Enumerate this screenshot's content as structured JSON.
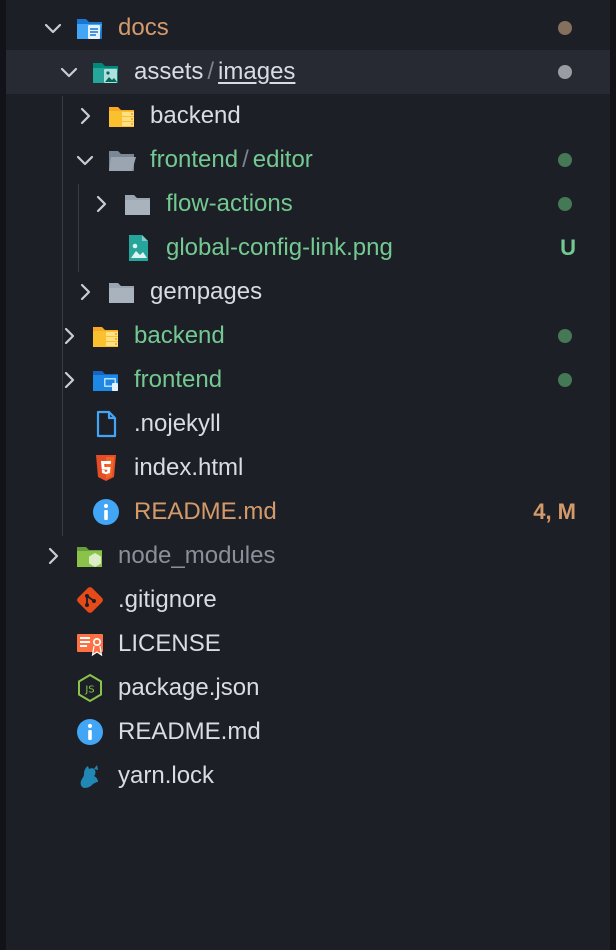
{
  "colors": {
    "modified": "#d49a6a",
    "untracked": "#73c991",
    "default": "#d8dce3",
    "ignored": "#8a8f99",
    "dot_modified": "#84705d",
    "dot_neutral": "#9a9ca3",
    "dot_untracked": "#457955"
  },
  "tree": [
    {
      "key": "docs",
      "label": "docs",
      "chevron": "down",
      "icon": "folder-docs-open-icon",
      "color": "modified",
      "dot": "dot_modified"
    },
    {
      "key": "assets",
      "label": "assets",
      "label2": "images",
      "chevron": "down",
      "icon": "folder-images-open-icon",
      "color": "default",
      "dot": "dot_neutral",
      "selected": true
    },
    {
      "key": "backend-sub",
      "label": "backend",
      "chevron": "right",
      "icon": "folder-backend-icon",
      "color": "default"
    },
    {
      "key": "frontend-sub",
      "label": "frontend",
      "label2": "editor",
      "chevron": "down",
      "icon": "folder-open-icon",
      "color": "untracked",
      "dot": "dot_untracked"
    },
    {
      "key": "flow-actions",
      "label": "flow-actions",
      "chevron": "right",
      "icon": "folder-icon",
      "color": "untracked",
      "dot": "dot_untracked"
    },
    {
      "key": "global-config",
      "label": "global-config-link.png",
      "icon": "image-file-icon",
      "color": "untracked",
      "badge": "U"
    },
    {
      "key": "gempages",
      "label": "gempages",
      "chevron": "right",
      "icon": "folder-icon",
      "color": "default"
    },
    {
      "key": "backend",
      "label": "backend",
      "chevron": "right",
      "icon": "folder-backend-icon",
      "color": "untracked",
      "dot": "dot_untracked"
    },
    {
      "key": "frontend",
      "label": "frontend",
      "chevron": "right",
      "icon": "folder-frontend-icon",
      "color": "untracked",
      "dot": "dot_untracked"
    },
    {
      "key": "nojekyll",
      "label": ".nojekyll",
      "icon": "file-icon",
      "color": "default"
    },
    {
      "key": "index-html",
      "label": "index.html",
      "icon": "html5-icon",
      "color": "default"
    },
    {
      "key": "readme-docs",
      "label": "README.md",
      "icon": "info-icon",
      "color": "modified",
      "badge": "4, M"
    },
    {
      "key": "node-modules",
      "label": "node_modules",
      "chevron": "right",
      "icon": "nodejs-folder-icon",
      "color": "ignored"
    },
    {
      "key": "gitignore",
      "label": ".gitignore",
      "icon": "git-icon",
      "color": "default"
    },
    {
      "key": "license",
      "label": "LICENSE",
      "icon": "license-icon",
      "color": "default"
    },
    {
      "key": "package-json",
      "label": "package.json",
      "icon": "nodejs-icon",
      "color": "default"
    },
    {
      "key": "readme-root",
      "label": "README.md",
      "icon": "info-icon",
      "color": "default"
    },
    {
      "key": "yarn-lock",
      "label": "yarn.lock",
      "icon": "yarn-icon",
      "color": "default"
    }
  ]
}
